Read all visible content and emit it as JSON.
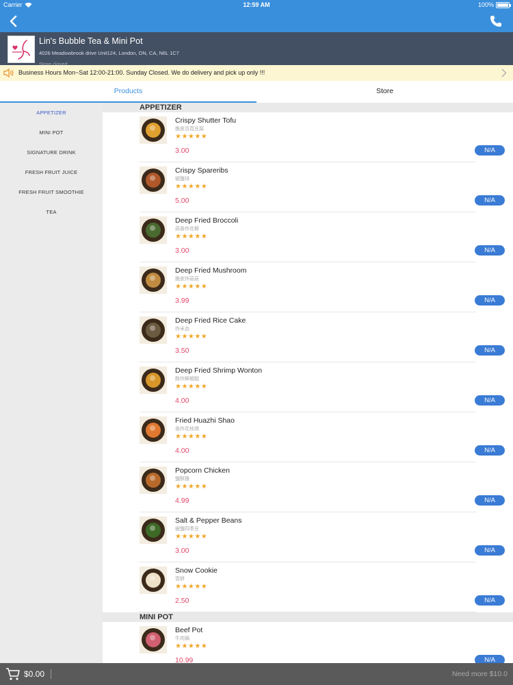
{
  "status": {
    "carrier": "Carrier",
    "time": "12:59 AM",
    "battery": "100%",
    "battery_level": 1.0
  },
  "store": {
    "name": "Lin's Bubble Tea & Mini Pot",
    "address": "4026 Meadowbrook drive Unit124, London, ON, CA, N6L 1C7",
    "sub": "Store closed"
  },
  "notice": {
    "text": "Business Hours  Mon~Sat 12:00-21:00. Sunday Closed. We do delivery and pick up only !!!"
  },
  "tabs": [
    {
      "label": "Products"
    },
    {
      "label": "Store"
    }
  ],
  "categories": [
    {
      "label": "APPETIZER"
    },
    {
      "label": "MINI POT"
    },
    {
      "label": "SIGNATURE DRINK"
    },
    {
      "label": "FRESH FRUIT JUICE"
    },
    {
      "label": "FRESH FRUIT SMOOTHIE"
    },
    {
      "label": "TEA"
    }
  ],
  "sections": [
    {
      "title": "APPETIZER",
      "items": [
        {
          "name": "Crispy Shutter Tofu",
          "sub": "脆皮百頁豆腐",
          "stars": "★★★★★",
          "price": "3.00",
          "action": "N/A",
          "food": "#e0a030"
        },
        {
          "name": "Crispy Spareribs",
          "sub": "椒鹽排",
          "stars": "★★★★★",
          "price": "5.00",
          "action": "N/A",
          "food": "#b0582a"
        },
        {
          "name": "Deep Fried Broccoli",
          "sub": "蒜香炸花椰",
          "stars": "★★★★★",
          "price": "3.00",
          "action": "N/A",
          "food": "#4a6a30"
        },
        {
          "name": "Deep Fried Mushroom",
          "sub": "脆皮炸菇菇",
          "stars": "★★★★★",
          "price": "3.99",
          "action": "N/A",
          "food": "#c08a40"
        },
        {
          "name": "Deep Fried Rice Cake",
          "sub": "炸米血",
          "stars": "★★★★★",
          "price": "3.50",
          "action": "N/A",
          "food": "#6a5a40"
        },
        {
          "name": "Deep Fried Shrimp Wonton",
          "sub": "酥炸鮮蝦餛",
          "stars": "★★★★★",
          "price": "4.00",
          "action": "N/A",
          "food": "#d8962a"
        },
        {
          "name": "Fried Huazhi Shao",
          "sub": "香炸花枝燒",
          "stars": "★★★★★",
          "price": "4.00",
          "action": "N/A",
          "food": "#e07830"
        },
        {
          "name": "Popcorn Chicken",
          "sub": "鹽酥雞",
          "stars": "★★★★★",
          "price": "4.99",
          "action": "N/A",
          "food": "#b8692a"
        },
        {
          "name": "Salt & Pepper Beans",
          "sub": "椒鹽四季豆",
          "stars": "★★★★★",
          "price": "3.00",
          "action": "N/A",
          "food": "#3e6a28"
        },
        {
          "name": "Snow Cookie",
          "sub": "雪餅",
          "stars": "★★★★★",
          "price": "2.50",
          "action": "N/A",
          "food": "#efe0c8"
        }
      ]
    },
    {
      "title": "MINI POT",
      "items": [
        {
          "name": "Beef Pot",
          "sub": "牛肉鍋",
          "stars": "★★★★★",
          "price": "10.99",
          "action": "N/A",
          "food": "#d06070"
        }
      ]
    }
  ],
  "footer": {
    "total": "$0.00",
    "need_more": "Need more $10.0"
  },
  "colors": {
    "primary": "#3a8fdc",
    "header": "#435063",
    "price": "#e0456a",
    "star": "#f1a82c",
    "na_button": "#3a7bd5"
  },
  "icons": {
    "back": "chevron-left-icon",
    "phone": "phone-icon",
    "speaker": "speaker-icon",
    "cart": "cart-icon",
    "wifi": "wifi-icon"
  }
}
